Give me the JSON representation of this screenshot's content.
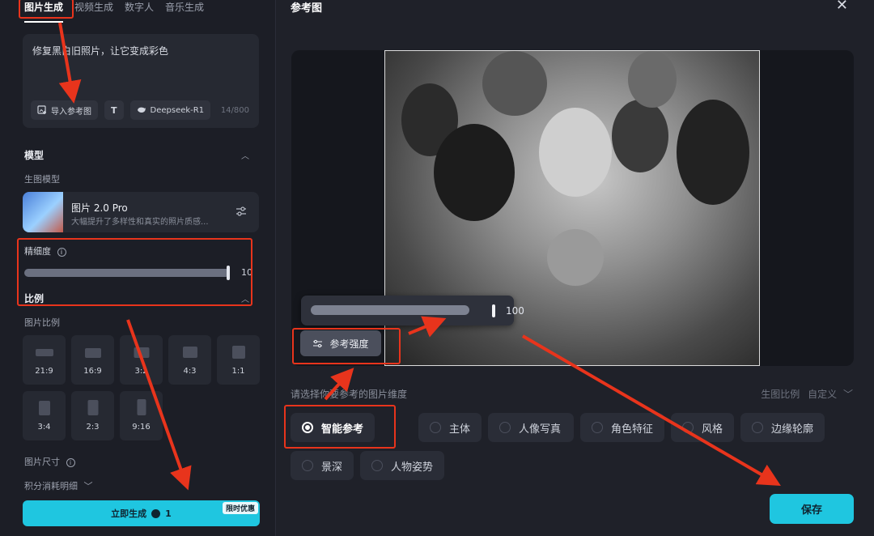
{
  "left": {
    "tabs": [
      {
        "label": "图片生成"
      },
      {
        "label": "视频生成"
      },
      {
        "label": "数字人"
      },
      {
        "label": "音乐生成"
      }
    ],
    "prompt": {
      "text": "修复黑白旧照片，让它变成彩色",
      "import_ref": "导入参考图",
      "text_tool": "T",
      "model_chip": "Deepseek-R1",
      "counter": "14/800"
    },
    "model_section": {
      "title": "模型",
      "sub_label": "生图模型",
      "model_name": "图片 2.0 Pro",
      "model_desc": "大幅提升了多样性和真实的照片质感..."
    },
    "precision": {
      "label": "精细度",
      "value": "10"
    },
    "ratio_section": {
      "title": "比例",
      "sub_label": "图片比例",
      "ratios": [
        {
          "label": "21:9"
        },
        {
          "label": "16:9"
        },
        {
          "label": "3:2"
        },
        {
          "label": "4:3"
        },
        {
          "label": "1:1"
        },
        {
          "label": "3:4"
        },
        {
          "label": "2:3"
        },
        {
          "label": "9:16"
        }
      ]
    },
    "size_label": "图片尺寸",
    "cost_label": "积分消耗明细",
    "generate": {
      "label": "立即生成",
      "count": "1",
      "badge": "限时优惠"
    }
  },
  "right": {
    "title": "参考图",
    "strength_value": "100",
    "strength_label": "参考强度",
    "dimension_prompt": "请选择你要参考的图片维度",
    "ratio_label": "生图比例",
    "ratio_value": "自定义",
    "options_row1": [
      {
        "label": "智能参考",
        "selected": true
      },
      {
        "label": "主体",
        "selected": false
      },
      {
        "label": "人像写真",
        "selected": false
      },
      {
        "label": "角色特征",
        "selected": false
      },
      {
        "label": "风格",
        "selected": false
      },
      {
        "label": "边缘轮廓",
        "selected": false
      }
    ],
    "options_row2": [
      {
        "label": "景深",
        "selected": false
      },
      {
        "label": "人物姿势",
        "selected": false
      }
    ],
    "save_label": "保存"
  },
  "colors": {
    "accent": "#1fc6e0",
    "annotation": "#e8341c",
    "panel_bg": "#1c1e26"
  },
  "icons": [
    "import-image-icon",
    "text-icon",
    "deepseek-icon",
    "settings-sliders-icon",
    "info-icon",
    "chevron-up-icon",
    "chevron-down-icon",
    "close-icon",
    "sliders-icon",
    "radio-icon",
    "coin-icon"
  ]
}
